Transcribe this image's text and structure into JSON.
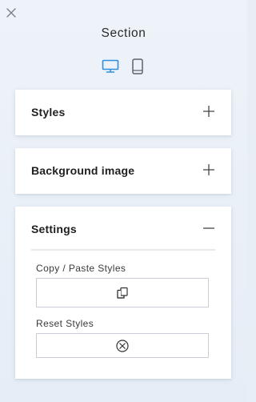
{
  "panel": {
    "title": "Section",
    "close_icon": "close-icon",
    "device_toggle": {
      "desktop_icon": "desktop-icon",
      "mobile_icon": "mobile-icon",
      "active": "desktop",
      "active_color": "#2f8fdc",
      "inactive_color": "#5a6270"
    }
  },
  "sections": [
    {
      "title": "Styles",
      "expanded": false,
      "toggle_icon": "plus-icon"
    },
    {
      "title": "Background image",
      "expanded": false,
      "toggle_icon": "plus-icon"
    },
    {
      "title": "Settings",
      "expanded": true,
      "toggle_icon": "minus-icon"
    }
  ],
  "settings": {
    "copy_paste_label": "Copy / Paste Styles",
    "copy_paste_icon": "copy-paste-icon",
    "reset_label": "Reset Styles",
    "reset_icon": "reset-icon"
  }
}
